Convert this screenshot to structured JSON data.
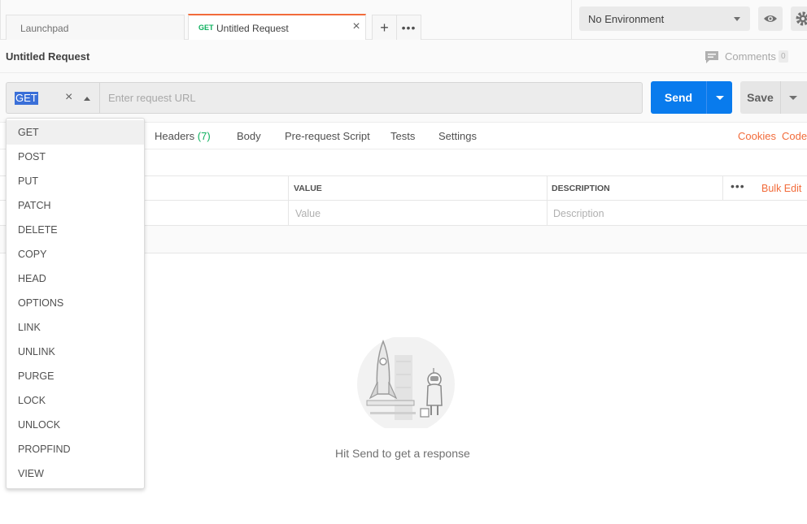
{
  "tabs": [
    {
      "label": "Launchpad"
    },
    {
      "method": "GET",
      "label": "Untitled Request",
      "close": "×"
    }
  ],
  "tab_add": "+",
  "tab_more": "•••",
  "environment": {
    "selected": "No Environment"
  },
  "icons": {
    "env_caret": "chevron-down-icon",
    "eye": "eye-icon",
    "gear": "gear-icon",
    "comment": "comment-icon",
    "rocket": "rocket-illustration"
  },
  "request": {
    "title": "Untitled Request",
    "comments_label": "Comments",
    "comments_count": "0"
  },
  "url_bar": {
    "method": "GET",
    "clear": "×",
    "placeholder": "Enter request URL",
    "send_label": "Send",
    "save_label": "Save"
  },
  "request_tabs": {
    "headers_label": "Headers",
    "headers_count": "(7)",
    "body": "Body",
    "pre_request": "Pre-request Script",
    "tests": "Tests",
    "settings": "Settings",
    "cookies": "Cookies",
    "code": "Code"
  },
  "params": {
    "col_value": "VALUE",
    "col_description": "DESCRIPTION",
    "more": "•••",
    "bulk_edit": "Bulk Edit",
    "value_placeholder": "Value",
    "description_placeholder": "Description"
  },
  "response": {
    "empty_text": "Hit Send to get a response"
  },
  "method_options": [
    "GET",
    "POST",
    "PUT",
    "PATCH",
    "DELETE",
    "COPY",
    "HEAD",
    "OPTIONS",
    "LINK",
    "UNLINK",
    "PURGE",
    "LOCK",
    "UNLOCK",
    "PROPFIND",
    "VIEW"
  ],
  "colors": {
    "accent": "#f26b3a",
    "send": "#097bed",
    "get_method": "#0cb05d"
  }
}
